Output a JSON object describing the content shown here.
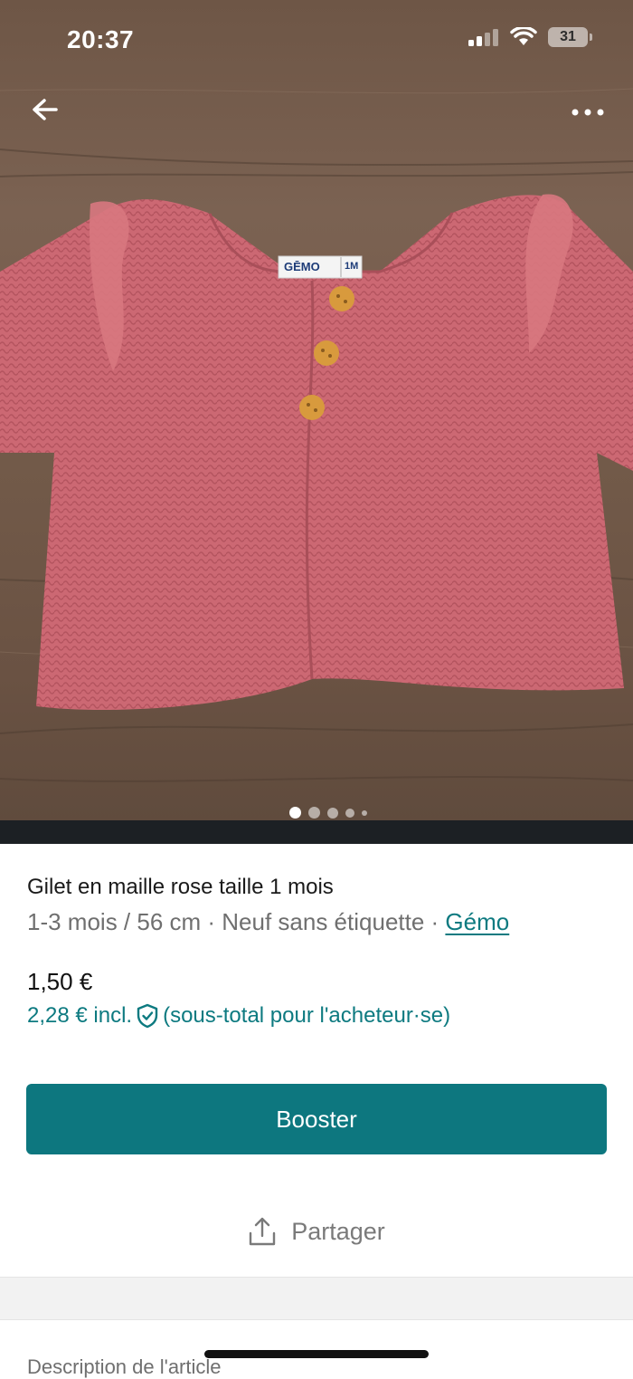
{
  "status_bar": {
    "time": "20:37",
    "battery": "31"
  },
  "photo": {
    "subject": "pink knitted baby cardigan with ruffled shoulders and three wooden buttons",
    "label_brand": "GĒMO",
    "label_size": "1M",
    "gallery_count": 5,
    "gallery_active": 0
  },
  "nav": {
    "back_icon": "arrow-left-icon",
    "more_icon": "more-horizontal-icon"
  },
  "item": {
    "title": "Gilet en maille rose taille 1 mois",
    "details": "1-3 mois / 56 cm · Neuf sans étiquette · ",
    "brand": "Gémo",
    "price": "1,50 €",
    "price_incl": "2,28 € incl.",
    "price_incl_note": "(sous-total pour l'acheteur·se)"
  },
  "actions": {
    "booster": "Booster",
    "share": "Partager"
  },
  "section": {
    "description_heading": "Description de l'article"
  },
  "colors": {
    "accent": "#0d777f",
    "link": "#0d7a80",
    "text_secondary": "#6f6f6f"
  }
}
